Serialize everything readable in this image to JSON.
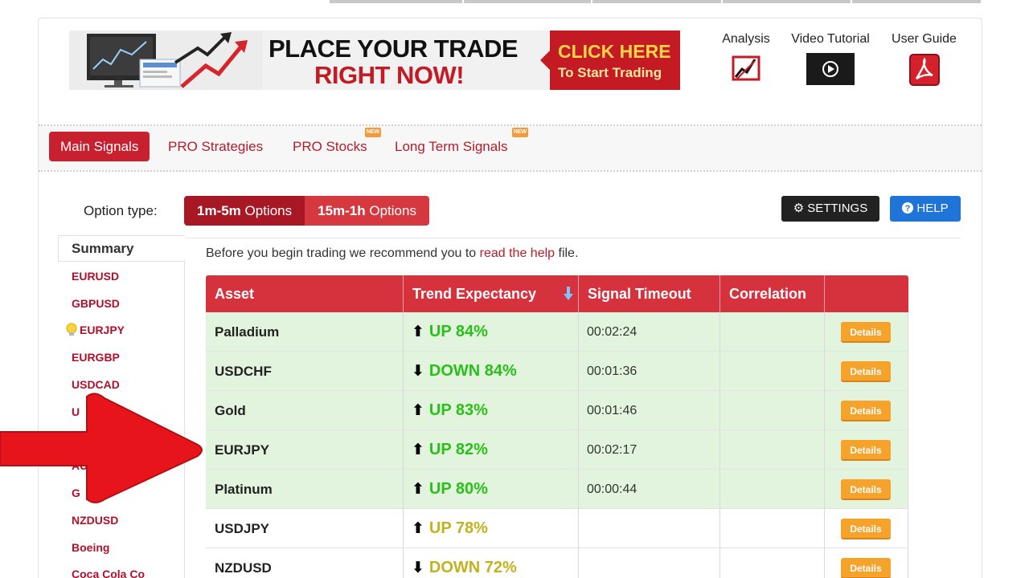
{
  "banner": {
    "line1": "PLACE YOUR TRADE",
    "line2": "RIGHT NOW!",
    "cta_line1": "CLICK HERE",
    "cta_line2": "To Start Trading"
  },
  "header_links": [
    {
      "label": "Analysis",
      "icon": "analysis-chart-icon"
    },
    {
      "label": "Video Tutorial",
      "icon": "play-icon"
    },
    {
      "label": "User Guide",
      "icon": "pdf-icon"
    }
  ],
  "tabs": [
    {
      "label": "Main Signals",
      "active": true,
      "is_new": false
    },
    {
      "label": "PRO Strategies",
      "active": false,
      "is_new": false
    },
    {
      "label": "PRO Stocks",
      "active": false,
      "is_new": true
    },
    {
      "label": "Long Term Signals",
      "active": false,
      "is_new": true
    }
  ],
  "new_badge_label": "NEW",
  "option_type": {
    "label": "Option type:",
    "options": [
      {
        "bold": "1m-5m",
        "rest": " Options",
        "selected": true
      },
      {
        "bold": "15m-1h",
        "rest": " Options",
        "selected": false
      }
    ]
  },
  "buttons": {
    "settings": "SETTINGS",
    "help": "HELP"
  },
  "sidebar": {
    "heading": "Summary",
    "items": [
      "EURUSD",
      "GBPUSD",
      "EURJPY",
      "EURGBP",
      "USDCAD",
      "U",
      "AUDU",
      "G",
      "NZDUSD",
      "Boeing",
      "Coca Cola Co"
    ],
    "highlighted_index": 2
  },
  "intro": {
    "before": "Before you begin trading we recommend you to ",
    "link": "read the help",
    "after": " file."
  },
  "table": {
    "headers": [
      "Asset",
      "Trend Expectancy",
      "Signal Timeout",
      "Correlation",
      ""
    ],
    "sort_icon": "sort-down-icon",
    "details_label": "Details",
    "rows": [
      {
        "asset": "Palladium",
        "direction": "up",
        "trend": "UP 84%",
        "timeout": "00:02:24",
        "correlation": "",
        "strength": "strong"
      },
      {
        "asset": "USDCHF",
        "direction": "down",
        "trend": "DOWN 84%",
        "timeout": "00:01:36",
        "correlation": "",
        "strength": "strong"
      },
      {
        "asset": "Gold",
        "direction": "up",
        "trend": "UP 83%",
        "timeout": "00:01:46",
        "correlation": "",
        "strength": "strong"
      },
      {
        "asset": "EURJPY",
        "direction": "up",
        "trend": "UP 82%",
        "timeout": "00:02:17",
        "correlation": "",
        "strength": "strong"
      },
      {
        "asset": "Platinum",
        "direction": "up",
        "trend": "UP 80%",
        "timeout": "00:00:44",
        "correlation": "",
        "strength": "strong"
      },
      {
        "asset": "USDJPY",
        "direction": "up",
        "trend": "UP 78%",
        "timeout": "",
        "correlation": "",
        "strength": "weak"
      },
      {
        "asset": "NZDUSD",
        "direction": "down",
        "trend": "DOWN 72%",
        "timeout": "",
        "correlation": "",
        "strength": "weak"
      }
    ]
  },
  "colors": {
    "brand_red": "#c8202f",
    "header_red": "#d5323e",
    "row_green": "#e2f4dd",
    "trend_strong": "#28c019",
    "trend_weak": "#c3b21e",
    "details_orange": "#f5a32b",
    "help_blue": "#1f74d8"
  }
}
